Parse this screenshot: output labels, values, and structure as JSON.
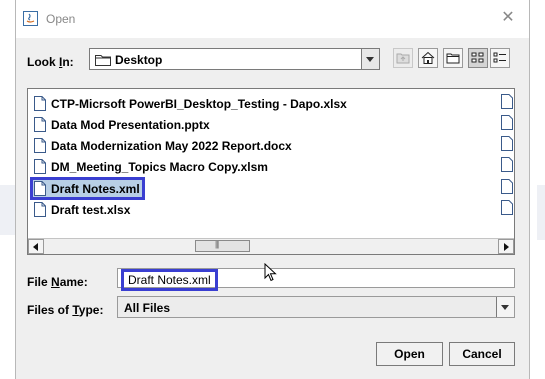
{
  "window": {
    "title": "Open"
  },
  "look_in": {
    "label_prefix": "Look ",
    "label_underlined": "I",
    "label_suffix": "n:",
    "value": "Desktop"
  },
  "toolbar": {
    "buttons": [
      {
        "name": "up-one-level",
        "icon": "folder-up-icon",
        "enabled": false
      },
      {
        "name": "home",
        "icon": "home-icon",
        "enabled": true
      },
      {
        "name": "new-folder",
        "icon": "new-folder-icon",
        "enabled": true
      },
      {
        "name": "list-view",
        "icon": "list-view-icon",
        "enabled": true,
        "pressed": true
      },
      {
        "name": "details-view",
        "icon": "details-view-icon",
        "enabled": true
      }
    ]
  },
  "files": [
    {
      "name": "CTP-Micrsoft PowerBI_Desktop_Testing - Dapo.xlsx",
      "selected": false
    },
    {
      "name": "Data Mod Presentation.pptx",
      "selected": false
    },
    {
      "name": "Data Modernization May 2022 Report.docx",
      "selected": false
    },
    {
      "name": "DM_Meeting_Topics Macro Copy.xlsm",
      "selected": false
    },
    {
      "name": "Draft Notes.xml",
      "selected": true
    },
    {
      "name": "Draft test.xlsx",
      "selected": false
    }
  ],
  "file_name": {
    "label_underlined": "N",
    "label_prefix": "File ",
    "label_suffix": "ame:",
    "value": "Draft Notes.xml"
  },
  "files_of_type": {
    "label_prefix": "Files of ",
    "label_underlined": "T",
    "label_suffix": "ype:",
    "value": "All Files"
  },
  "buttons": {
    "open": "Open",
    "cancel": "Cancel"
  }
}
